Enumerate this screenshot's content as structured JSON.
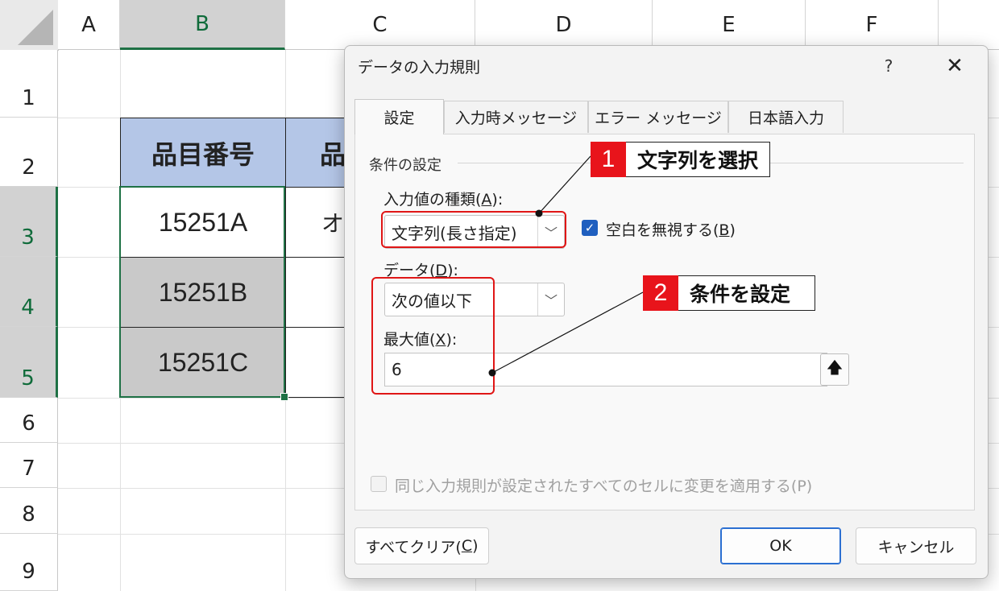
{
  "sheet": {
    "columns": [
      "A",
      "B",
      "C",
      "D",
      "E",
      "F"
    ],
    "rows": [
      "1",
      "2",
      "3",
      "4",
      "5",
      "6",
      "7",
      "8",
      "9"
    ],
    "header_cells": {
      "b2": "品目番号",
      "c2_partial": "品"
    },
    "cells": {
      "b3": "15251A",
      "b4": "15251B",
      "b5": "15251C",
      "c3_partial": "オ"
    }
  },
  "dialog": {
    "title": "データの入力規則",
    "help": "?",
    "close": "✕",
    "tabs": [
      "設定",
      "入力時メッセージ",
      "エラー メッセージ",
      "日本語入力"
    ],
    "group_label": "条件の設定",
    "allow_label_pre": "入力値の種類(",
    "allow_label_key": "A",
    "allow_label_post": "):",
    "allow_value": "文字列(長さ指定)",
    "ignore_blank_pre": "空白を無視する(",
    "ignore_blank_key": "B",
    "ignore_blank_post": ")",
    "data_label_pre": "データ(",
    "data_label_key": "D",
    "data_label_post": "):",
    "data_value": "次の値以下",
    "max_label_pre": "最大値(",
    "max_label_key": "X",
    "max_label_post": "):",
    "max_value": "6",
    "apply_all": "同じ入力規則が設定されたすべてのセルに変更を適用する(P)",
    "clear_all_pre": "すべてクリア(",
    "clear_all_key": "C",
    "clear_all_post": ")",
    "ok": "OK",
    "cancel": "キャンセル"
  },
  "annotations": [
    {
      "number": "1",
      "text": "文字列を選択"
    },
    {
      "number": "2",
      "text": "条件を設定"
    }
  ],
  "colors": {
    "header_fill": "#b4c6e7",
    "gray_fill": "#c9c9c9",
    "excel_green": "#1e7145",
    "annotation_red": "#e8141b",
    "checkbox_blue": "#1f5fbf"
  }
}
